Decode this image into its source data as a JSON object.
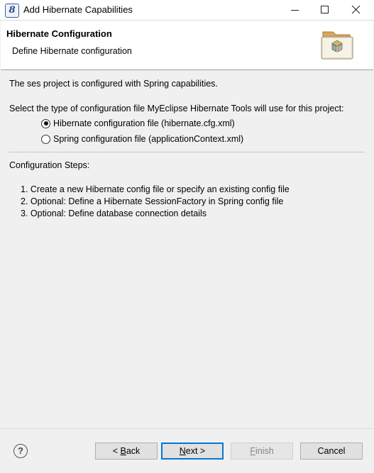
{
  "window": {
    "app_icon_glyph": "8",
    "title": "Add Hibernate Capabilities"
  },
  "header": {
    "title": "Hibernate Configuration",
    "subtitle": "Define Hibernate configuration"
  },
  "content": {
    "info": "The ses project is configured with Spring capabilities.",
    "select_prompt": "Select the type of configuration file MyEclipse Hibernate Tools will use for this project:",
    "options": [
      {
        "label": "Hibernate configuration file (hibernate.cfg.xml)",
        "selected": true
      },
      {
        "label": "Spring configuration file (applicationContext.xml)",
        "selected": false
      }
    ],
    "steps_heading": "Configuration Steps:",
    "steps": [
      "1. Create a new Hibernate config file or specify an existing config file",
      "2. Optional: Define a Hibernate SessionFactory in Spring config file",
      "3. Optional: Define database connection details"
    ]
  },
  "footer": {
    "help_glyph": "?",
    "back_prefix": "< ",
    "back_key": "B",
    "back_rest": "ack",
    "next_key": "N",
    "next_rest": "ext >",
    "finish_key": "F",
    "finish_rest": "inish",
    "cancel": "Cancel"
  },
  "colors": {
    "default_button_border": "#0078d7",
    "disabled_text": "#838383"
  }
}
